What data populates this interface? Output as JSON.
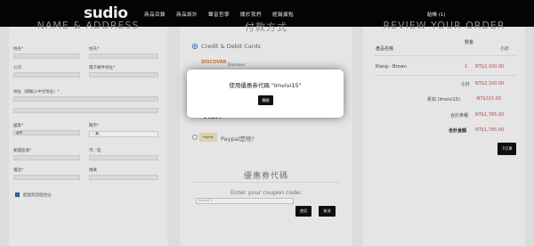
{
  "brand": {
    "logo": "sudio"
  },
  "nav": {
    "items": [
      "商品目錄",
      "商品設計",
      "聲音哲學",
      "關於我們",
      "經銷據點"
    ],
    "cart": "結帳 (1)"
  },
  "left": {
    "title": "NAME & ADDRESS",
    "fields": {
      "last_name": "姓名*",
      "first_name": "姓氏*",
      "company": "公司",
      "email": "電子郵件地址*",
      "address": "地址（請輸入中文地址）*",
      "country": "國家*",
      "country_value": "台灣",
      "state": "縣市*",
      "state_value": "- 無 -",
      "zip": "郵遞區號*",
      "city": "市／區",
      "phone": "電話*",
      "fax": "傳真"
    },
    "checkbox_label": "配送到這個住址"
  },
  "mid": {
    "title": "付款方式",
    "payment_options": [
      "Credit & Debit Cards",
      "Paypal是啥?"
    ],
    "card_logos": [
      "DISCOVER",
      "Discover",
      "VISA"
    ],
    "coupon_title": "優惠券代碼",
    "coupon_sub": "Enter your coupon code:",
    "coupon_input_value": "Imvivi1 5",
    "apply_button": "使用",
    "cancel_button": "取消"
  },
  "right": {
    "title": "REVIEW YOUR ORDER",
    "col_product": "產品名稱",
    "col_qty": "數量",
    "col_subtotal": "小計",
    "item_name": "Klang - Brown",
    "item_qty": "1",
    "item_price": "NT$2,100.00",
    "subtotal_label": "小計",
    "subtotal_value": "NT$2,100.00",
    "discount_label": "折扣 (Imvivi15)",
    "discount_value": "-NT$315.00",
    "total_label": "合計來積",
    "total_value": "NT$1,785.00",
    "grand_label": "合計金額",
    "grand_value": "NT$1,785.00",
    "order_button": "下訂單"
  },
  "modal": {
    "message": "使用優惠券代碼 \"Imvivi15\"",
    "close_button": "關閉"
  }
}
